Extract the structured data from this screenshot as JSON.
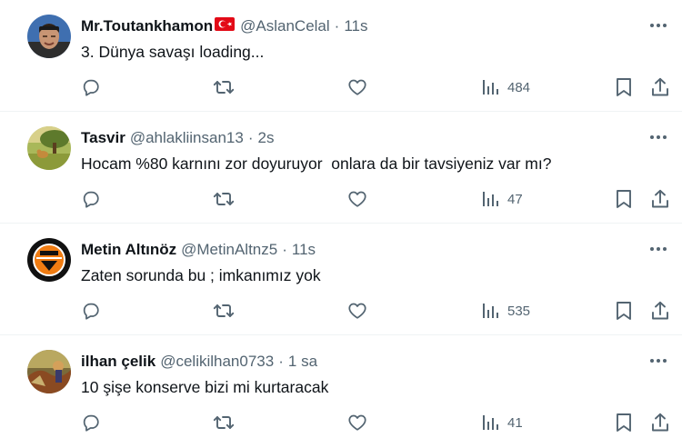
{
  "tweets": [
    {
      "name": "Mr.Toutankhamon",
      "has_flag": true,
      "handle": "@AslanCelal",
      "separator": "·",
      "time": "11s",
      "text": "3. Dünya savaşı loading...",
      "views": "484"
    },
    {
      "name": "Tasvir",
      "has_flag": false,
      "handle": "@ahlakliinsan13",
      "separator": "·",
      "time": "2s",
      "text": "Hocam %80 karnını zor doyuruyor  onlara da bir tavsiyeniz var mı?",
      "views": "47"
    },
    {
      "name": "Metin Altınöz",
      "has_flag": false,
      "handle": "@MetinAltnz5",
      "separator": "·",
      "time": "11s",
      "text": "Zaten sorunda bu ; imkanımız yok",
      "views": "535"
    },
    {
      "name": "ilhan çelik",
      "has_flag": false,
      "handle": "@celikilhan0733",
      "separator": "·",
      "time": "1 sa",
      "text": "10 şişe konserve bizi mi kurtaracak",
      "views": "41"
    }
  ],
  "icons": {
    "more": "more-horizontal-icon",
    "reply": "reply-icon",
    "retweet": "retweet-icon",
    "like": "heart-icon",
    "views": "views-bar-chart-icon",
    "bookmark": "bookmark-icon",
    "share": "share-icon"
  },
  "colors": {
    "text": "#0f1419",
    "secondary": "#536471",
    "divider": "#eff3f4",
    "flag_red": "#e30a17"
  }
}
